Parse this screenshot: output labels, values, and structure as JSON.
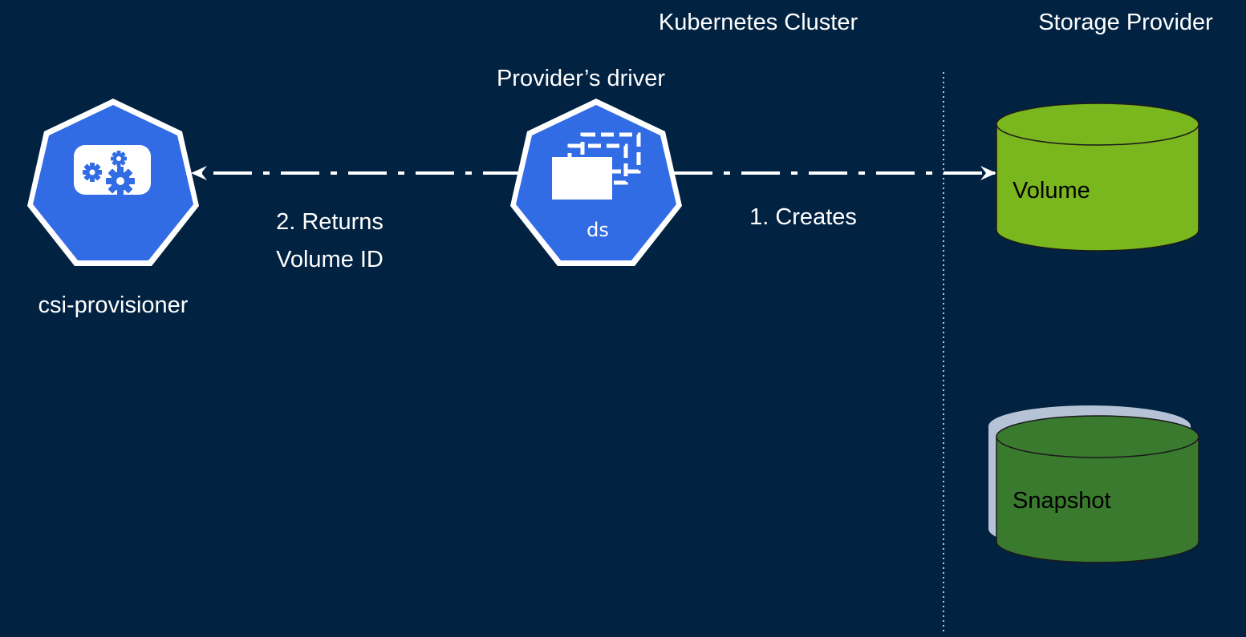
{
  "headers": {
    "cluster": "Kubernetes Cluster",
    "provider": "Storage Provider"
  },
  "nodes": {
    "provisioner": {
      "label": "csi-provisioner",
      "icon": "gears-icon"
    },
    "driver": {
      "label": "Provider’s driver",
      "icon_text": "ds",
      "icon": "daemonset-icon"
    },
    "volume": {
      "label": "Volume"
    },
    "snapshot": {
      "label": "Snapshot"
    }
  },
  "edges": {
    "creates": "1. Creates",
    "returns_line1": "2. Returns",
    "returns_line2": "Volume ID"
  },
  "colors": {
    "background": "#012241",
    "k8s_blue": "#326ce5",
    "volume_green": "#7ab61e",
    "snapshot_green": "#3a7a2e",
    "snapshot_shadow": "#b6c3d6",
    "white": "#ffffff"
  }
}
